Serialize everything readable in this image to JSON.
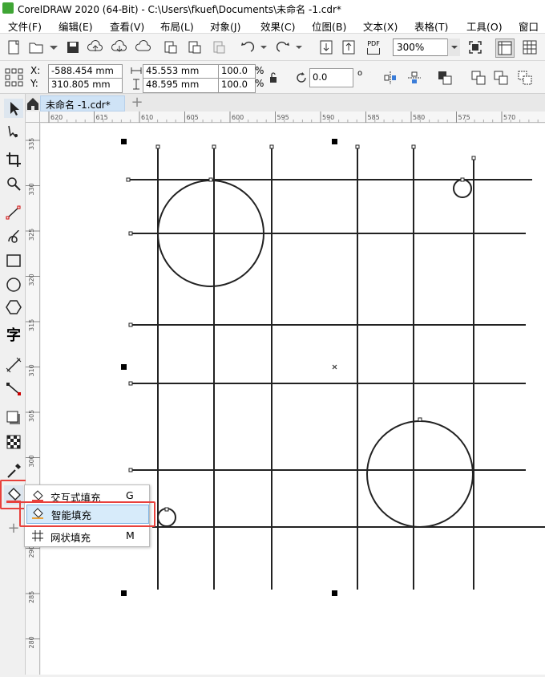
{
  "window": {
    "title": "CorelDRAW 2020 (64-Bit) - C:\\Users\\fkuef\\Documents\\未命名 -1.cdr*"
  },
  "menubar": {
    "items": [
      "文件(F)",
      "编辑(E)",
      "查看(V)",
      "布局(L)",
      "对象(J)",
      "效果(C)",
      "位图(B)",
      "文本(X)",
      "表格(T)",
      "工具(O)",
      "窗口"
    ]
  },
  "toolbar": {
    "zoom_value": "300%",
    "pdf_label": "PDF"
  },
  "property_bar": {
    "x_label": "X:",
    "y_label": "Y:",
    "x_value": "-588.454 mm",
    "y_value": "310.805 mm",
    "width_value": "45.553 mm",
    "height_value": "48.595 mm",
    "scale_x": "100.0",
    "scale_y": "100.0",
    "percent": "%",
    "rotation_value": "0.0",
    "degree_symbol": "o"
  },
  "document_tab": {
    "label": "未命名 -1.cdr*"
  },
  "rulers": {
    "horizontal_ticks": [
      "620",
      "615",
      "610",
      "605",
      "600",
      "595",
      "590",
      "585",
      "580",
      "575",
      "570"
    ],
    "vertical_ticks": [
      "335",
      "330",
      "325",
      "320",
      "315",
      "310",
      "305",
      "300",
      "295",
      "290",
      "285",
      "280"
    ]
  },
  "fill_flyout": {
    "items": [
      {
        "label": "交互式填充",
        "shortcut": "G",
        "highlighted": false
      },
      {
        "label": "智能填充",
        "shortcut": "",
        "highlighted": true
      },
      {
        "label": "网状填充",
        "shortcut": "M",
        "highlighted": false
      }
    ]
  },
  "colors": {
    "highlight_red": "#e8413c",
    "selected_item_bg": "#d7ebfa",
    "tab_blue": "#cfe3f6",
    "app_green": "#3fa535"
  }
}
